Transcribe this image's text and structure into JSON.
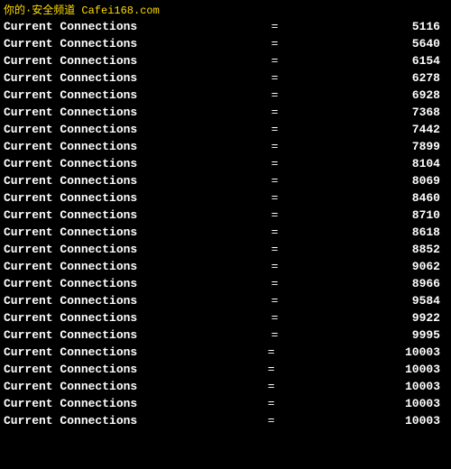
{
  "watermark": {
    "text": "你的·安全频道 Cafei168.com"
  },
  "rows": [
    {
      "label": "Current Connections",
      "value": "5116"
    },
    {
      "label": "Current Connections",
      "value": "5640"
    },
    {
      "label": "Current Connections",
      "value": "6154"
    },
    {
      "label": "Current Connections",
      "value": "6278"
    },
    {
      "label": "Current Connections",
      "value": "6928"
    },
    {
      "label": "Current Connections",
      "value": "7368"
    },
    {
      "label": "Current Connections",
      "value": "7442"
    },
    {
      "label": "Current Connections",
      "value": "7899"
    },
    {
      "label": "Current Connections",
      "value": "8104"
    },
    {
      "label": "Current Connections",
      "value": "8069"
    },
    {
      "label": "Current Connections",
      "value": "8460"
    },
    {
      "label": "Current Connections",
      "value": "8710"
    },
    {
      "label": "Current Connections",
      "value": "8618"
    },
    {
      "label": "Current Connections",
      "value": "8852"
    },
    {
      "label": "Current Connections",
      "value": "9062"
    },
    {
      "label": "Current Connections",
      "value": "8966"
    },
    {
      "label": "Current Connections",
      "value": "9584"
    },
    {
      "label": "Current Connections",
      "value": "9922"
    },
    {
      "label": "Current Connections",
      "value": "9995"
    },
    {
      "label": "Current Connections",
      "value": "10003"
    },
    {
      "label": "Current Connections",
      "value": "10003"
    },
    {
      "label": "Current Connections",
      "value": "10003"
    },
    {
      "label": "Current Connections",
      "value": "10003"
    },
    {
      "label": "Current Connections",
      "value": "10003"
    }
  ]
}
